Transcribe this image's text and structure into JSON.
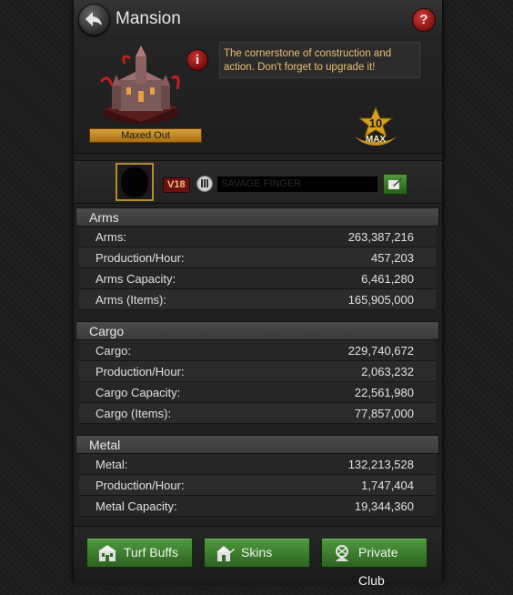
{
  "header": {
    "title": "Mansion",
    "help_label": "?"
  },
  "building": {
    "maxed_label": "Maxed Out",
    "info_label": "i",
    "description": "The cornerstone of construction and action. Don't forget to upgrade it!",
    "level": "10",
    "level_tag": "MAX"
  },
  "player": {
    "vip": "V18",
    "name": "SAVAGE FINGER"
  },
  "sections": {
    "arms": {
      "title": "Arms",
      "rows": [
        {
          "label": "Arms:",
          "value": "263,387,216"
        },
        {
          "label": "Production/Hour:",
          "value": "457,203"
        },
        {
          "label": "Arms Capacity:",
          "value": "6,461,280"
        },
        {
          "label": "Arms (Items):",
          "value": "165,905,000"
        }
      ]
    },
    "cargo": {
      "title": "Cargo",
      "rows": [
        {
          "label": "Cargo:",
          "value": "229,740,672"
        },
        {
          "label": "Production/Hour:",
          "value": "2,063,232"
        },
        {
          "label": "Cargo Capacity:",
          "value": "22,561,980"
        },
        {
          "label": "Cargo (Items):",
          "value": "77,857,000"
        }
      ]
    },
    "metal": {
      "title": "Metal",
      "rows": [
        {
          "label": "Metal:",
          "value": "132,213,528"
        },
        {
          "label": "Production/Hour:",
          "value": "1,747,404"
        },
        {
          "label": "Metal Capacity:",
          "value": "19,344,360"
        }
      ]
    }
  },
  "bottom": {
    "turf_buffs": "Turf Buffs",
    "skins": "Skins",
    "private_club": "Private Club"
  },
  "colors": {
    "accent_gold": "#e8c070",
    "button_green": "#3f8a30",
    "badge_red": "#8a1414"
  }
}
